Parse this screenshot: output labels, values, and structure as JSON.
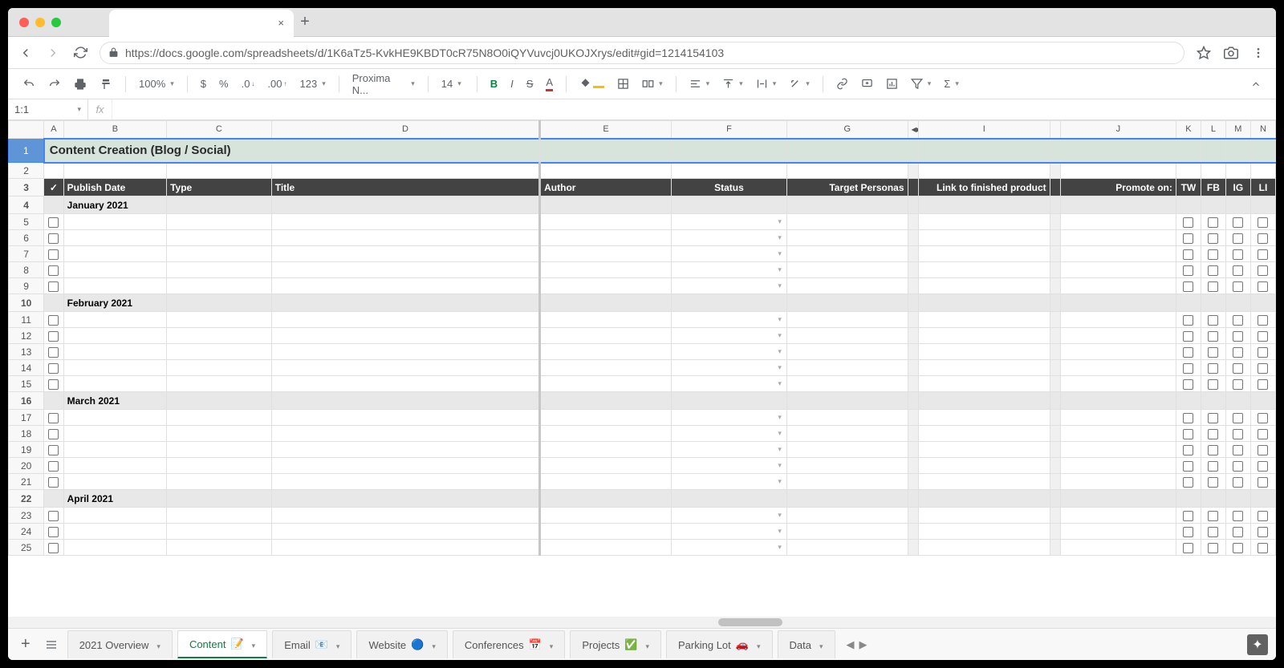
{
  "url": "https://docs.google.com/spreadsheets/d/1K6aTz5-KvkHE9KBDT0cR75N8O0iQYVuvcj0UKOJXrys/edit#gid=1214154103",
  "namebox": "1:1",
  "toolbar": {
    "zoom": "100%",
    "font": "Proxima N...",
    "fontsize": "14",
    "moreformats": "123"
  },
  "sheet": {
    "title": "Content Creation (Blog / Social)",
    "columns": [
      "A",
      "B",
      "C",
      "D",
      "E",
      "F",
      "G",
      "I",
      "J",
      "K",
      "L",
      "M",
      "N"
    ],
    "headers": {
      "A": "✓",
      "B": "Publish Date",
      "C": "Type",
      "D": "Title",
      "E": "Author",
      "F": "Status",
      "G": "Target Personas",
      "I": "Link to finished product",
      "J": "Promote on:",
      "K": "TW",
      "L": "FB",
      "M": "IG",
      "N": "LI"
    },
    "months": {
      "4": "January 2021",
      "10": "February 2021",
      "16": "March 2021",
      "22": "April 2021"
    },
    "data_rows": [
      5,
      6,
      7,
      8,
      9,
      11,
      12,
      13,
      14,
      15,
      17,
      18,
      19,
      20,
      21,
      23,
      24,
      25
    ]
  },
  "tabs": [
    {
      "label": "2021 Overview",
      "active": false,
      "icon": ""
    },
    {
      "label": "Content",
      "active": true,
      "icon": "📝"
    },
    {
      "label": "Email",
      "active": false,
      "icon": "📧"
    },
    {
      "label": "Website",
      "active": false,
      "icon": "🔵"
    },
    {
      "label": "Conferences",
      "active": false,
      "icon": "📅"
    },
    {
      "label": "Projects",
      "active": false,
      "icon": "✅"
    },
    {
      "label": "Parking Lot",
      "active": false,
      "icon": "🚗"
    },
    {
      "label": "Data",
      "active": false,
      "icon": ""
    }
  ]
}
